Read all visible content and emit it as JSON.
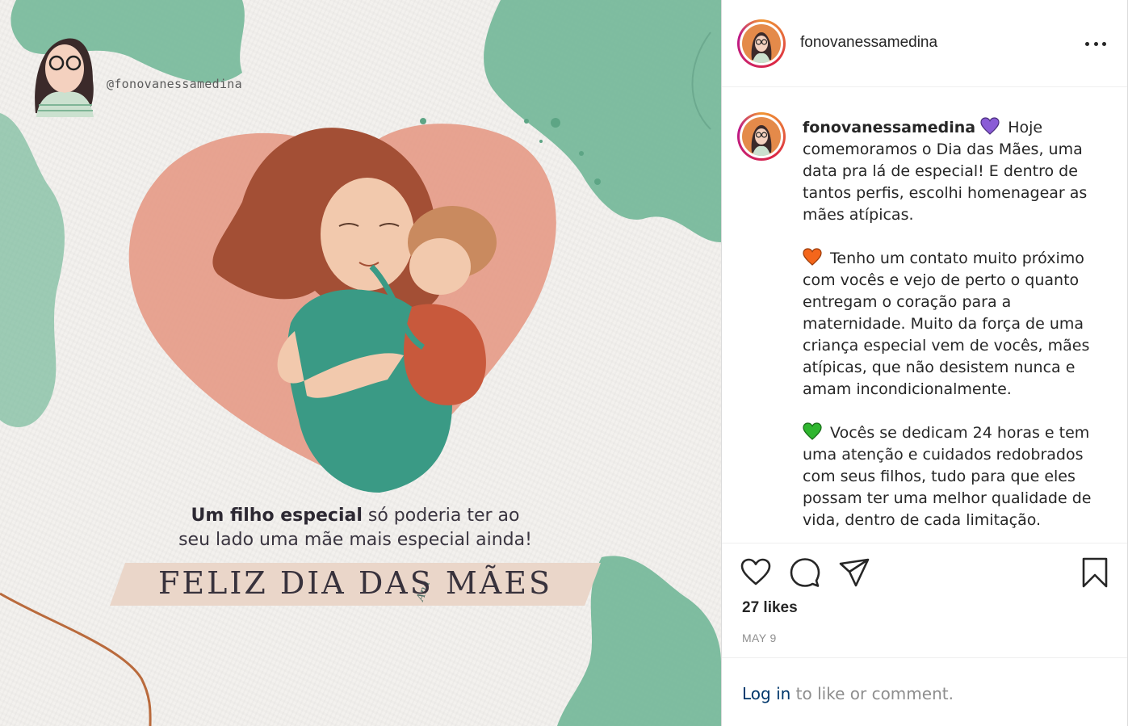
{
  "post_image": {
    "handle": "@fonovanessamedina",
    "tagline_bold": "Um filho especial",
    "tagline_rest": " só poderia ter ao",
    "tagline_line2": "seu lado uma mãe mais especial ainda!",
    "banner": "FELIZ DIA DAS MÃES",
    "signature": "Ana"
  },
  "header": {
    "username": "fonovanessamedina",
    "more_icon": "more-options-icon"
  },
  "caption": {
    "username": "fonovanessamedina",
    "p1": "Hoje comemoramos o Dia das Mães, uma data pra lá de especial! E dentro de tantos perfis, escolhi homenagear as mães atípicas.",
    "p2": "Tenho um contato muito próximo com vocês e vejo de perto o quanto entregam o coração para a maternidade. Muito da força de uma criança especial vem de vocês, mães atípicas, que não desistem nunca e amam incondicionalmente.",
    "p3": "Vocês se dedicam 24 horas e tem uma atenção e cuidados redobrados com seus filhos, tudo para que eles possam ter uma melhor qualidade de vida, dentro de cada limitação.",
    "emoji_colors": {
      "p1": "#8a5cd6",
      "p2": "#f4661b",
      "p3": "#2fb62f"
    }
  },
  "actions": {
    "likes": "27 likes",
    "date": "MAY 9",
    "icons": [
      "heart-icon",
      "comment-icon",
      "share-icon",
      "bookmark-icon"
    ]
  },
  "login": {
    "link": "Log in",
    "rest": " to like or comment."
  },
  "colors": {
    "green_wash": "#6fb596",
    "heart_pink": "#e59a86",
    "banner_bg": "#ead6c9",
    "link": "#00376b"
  }
}
